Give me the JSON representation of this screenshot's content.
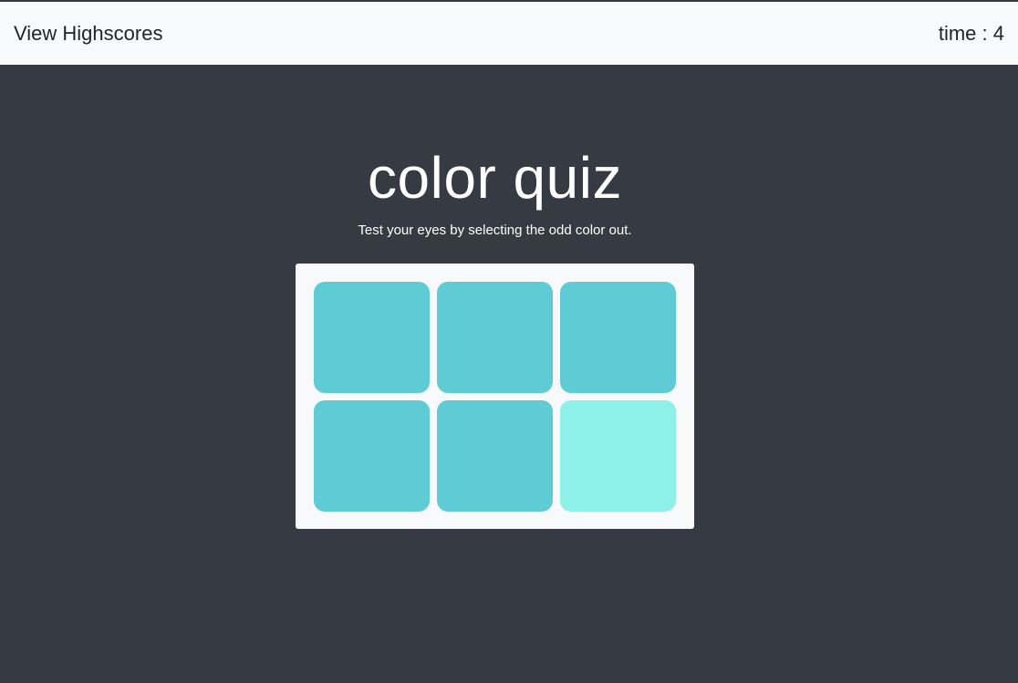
{
  "navbar": {
    "highscores_label": "View Highscores",
    "timer_label": "time : 4"
  },
  "header": {
    "title": "color quiz",
    "subtitle": "Test your eyes by selecting the odd color out."
  },
  "board": {
    "tiles": [
      {
        "color": "#5fccd5"
      },
      {
        "color": "#5fccd5"
      },
      {
        "color": "#5fccd5"
      },
      {
        "color": "#5fccd5"
      },
      {
        "color": "#5fccd5"
      },
      {
        "color": "#8ff0ea"
      }
    ]
  },
  "colors": {
    "background": "#363a43",
    "navbar": "#f8f9fa",
    "board": "#f8f9fa",
    "tile_base": "#5fccd5",
    "tile_odd": "#8ff0ea"
  }
}
